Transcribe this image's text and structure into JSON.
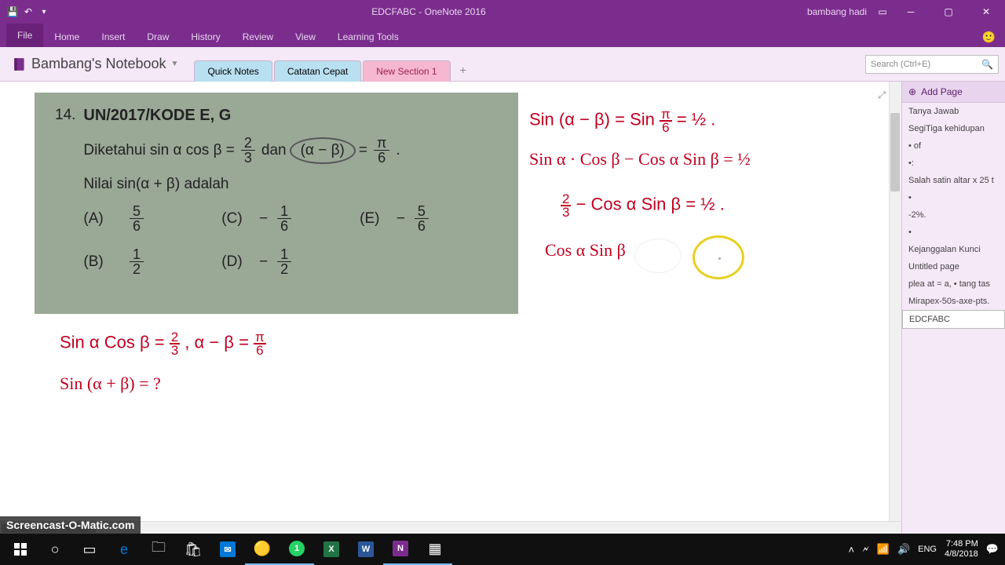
{
  "titlebar": {
    "doc": "EDCFABC",
    "app": "OneNote 2016",
    "separator": " - ",
    "user": "bambang hadi"
  },
  "ribbon": {
    "tabs": [
      "File",
      "Home",
      "Insert",
      "Draw",
      "History",
      "Review",
      "View",
      "Learning Tools"
    ]
  },
  "toolbar": {
    "notebook": "Bambang's Notebook",
    "sections": [
      "Quick Notes",
      "Catatan Cepat",
      "New Section 1"
    ],
    "search_placeholder": "Search (Ctrl+E)"
  },
  "page_panel": {
    "add_label": "Add Page",
    "pages": [
      "Tanya Jawab",
      "SegiTiga kehidupan",
      "• of",
      "•:",
      "Salah satin altar x 25 t",
      "•",
      "-2%.",
      "•",
      "Kejanggalan Kunci",
      "Untitled page",
      "plea at = a, • tang tas",
      "Mirapex-50s-axe-pts.",
      "EDCFABC"
    ],
    "selected_index": 12
  },
  "problem": {
    "number": "14.",
    "title": "UN/2017/KODE E, G",
    "line1a": "Diketahui sin α cos β =",
    "frac1_n": "2",
    "frac1_d": "3",
    "line1b": "dan",
    "ellipse": "(α − β)",
    "line1c": "=",
    "frac2_n": "π",
    "frac2_d": "6",
    "line1d": ".",
    "line2": "Nilai sin(α + β) adalah",
    "choices": {
      "A": {
        "label": "(A)",
        "n": "5",
        "d": "6",
        "neg": ""
      },
      "B": {
        "label": "(B)",
        "n": "1",
        "d": "2",
        "neg": ""
      },
      "C": {
        "label": "(C)",
        "n": "1",
        "d": "6",
        "neg": "−"
      },
      "D": {
        "label": "(D)",
        "n": "1",
        "d": "2",
        "neg": "−"
      },
      "E": {
        "label": "(E)",
        "n": "5",
        "d": "6",
        "neg": "−"
      }
    }
  },
  "ink": {
    "l1a": "Sin (α − β) =  Sin ",
    "l1f_n": "π",
    "l1f_d": "6",
    "l1b": " = ½ .",
    "l2": "Sin α · Cos β − Cos α Sin β = ½",
    "l3a_n": "2",
    "l3a_d": "3",
    "l3b": " − Cos α Sin β = ½ .",
    "l4": "Cos α Sin β",
    "l5a": "Sin α Cos β  = ",
    "l5a_n": "2",
    "l5a_d": "3",
    "l5b": "  ,   α − β = ",
    "l5b_n": "π",
    "l5b_d": "6",
    "l6": "Sin (α + β) = ?"
  },
  "watermark": "Screencast-O-Matic.com",
  "tray": {
    "lang": "ENG",
    "time": "7:48 PM",
    "date": "4/8/2018"
  }
}
